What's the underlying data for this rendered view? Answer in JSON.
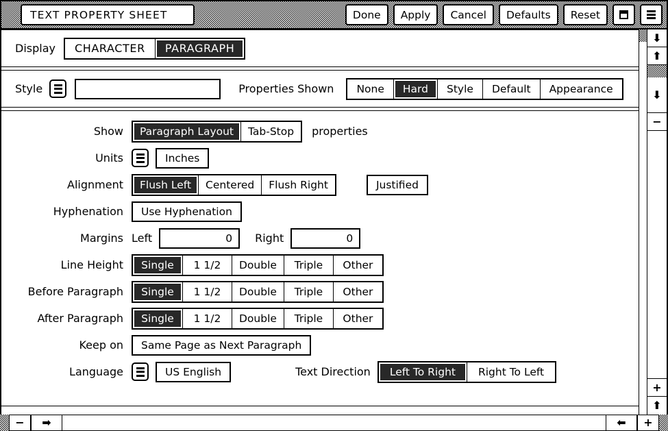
{
  "window": {
    "title": "TEXT PROPERTY SHEET",
    "buttons": [
      {
        "label": "Done",
        "name": "done-button"
      },
      {
        "label": "Apply",
        "name": "apply-button"
      },
      {
        "label": "Cancel",
        "name": "cancel-button"
      },
      {
        "label": "Defaults",
        "name": "defaults-button"
      },
      {
        "label": "Reset",
        "name": "reset-button"
      }
    ],
    "icon_buttons": [
      {
        "icon": "window-icon"
      },
      {
        "icon": "menu-icon"
      }
    ]
  },
  "display": {
    "label": "Display",
    "options": [
      {
        "label": "CHARACTER",
        "selected": false
      },
      {
        "label": "PARAGRAPH",
        "selected": true
      }
    ]
  },
  "style": {
    "label": "Style",
    "menu_icon": "menu-icon",
    "value": "",
    "placeholder": ""
  },
  "properties_shown": {
    "label": "Properties Shown",
    "options": [
      {
        "label": "None",
        "selected": false
      },
      {
        "label": "Hard",
        "selected": true
      },
      {
        "label": "Style",
        "selected": false
      },
      {
        "label": "Default",
        "selected": false
      },
      {
        "label": "Appearance",
        "selected": false
      }
    ]
  },
  "show": {
    "label": "Show",
    "suffix": "properties",
    "options": [
      {
        "label": "Paragraph Layout",
        "selected": true
      },
      {
        "label": "Tab-Stop",
        "selected": false
      }
    ]
  },
  "units": {
    "label": "Units",
    "menu_icon": "menu-icon",
    "value": "Inches"
  },
  "alignment": {
    "label": "Alignment",
    "options": [
      {
        "label": "Flush Left",
        "selected": true
      },
      {
        "label": "Centered",
        "selected": false
      },
      {
        "label": "Flush Right",
        "selected": false
      }
    ],
    "justified": {
      "label": "Justified",
      "selected": false
    }
  },
  "hyphenation": {
    "label": "Hyphenation",
    "toggle": {
      "label": "Use Hyphenation",
      "selected": false
    }
  },
  "margins": {
    "label": "Margins",
    "left_label": "Left",
    "left_value": "0",
    "right_label": "Right",
    "right_value": "0"
  },
  "line_height": {
    "label": "Line Height",
    "options": [
      {
        "label": "Single",
        "selected": true
      },
      {
        "label": "1 1/2",
        "selected": false
      },
      {
        "label": "Double",
        "selected": false
      },
      {
        "label": "Triple",
        "selected": false
      },
      {
        "label": "Other",
        "selected": false
      }
    ]
  },
  "before_paragraph": {
    "label": "Before Paragraph",
    "options": [
      {
        "label": "Single",
        "selected": true
      },
      {
        "label": "1 1/2",
        "selected": false
      },
      {
        "label": "Double",
        "selected": false
      },
      {
        "label": "Triple",
        "selected": false
      },
      {
        "label": "Other",
        "selected": false
      }
    ]
  },
  "after_paragraph": {
    "label": "After Paragraph",
    "options": [
      {
        "label": "Single",
        "selected": true
      },
      {
        "label": "1 1/2",
        "selected": false
      },
      {
        "label": "Double",
        "selected": false
      },
      {
        "label": "Triple",
        "selected": false
      },
      {
        "label": "Other",
        "selected": false
      }
    ]
  },
  "keep_on": {
    "label": "Keep on",
    "toggle": {
      "label": "Same Page as Next Paragraph",
      "selected": false
    }
  },
  "language": {
    "label": "Language",
    "menu_icon": "menu-icon",
    "value": "US English"
  },
  "text_direction": {
    "label": "Text Direction",
    "options": [
      {
        "label": "Left To Right",
        "selected": true
      },
      {
        "label": "Right To Left",
        "selected": false
      }
    ]
  },
  "scrollbars": {
    "vertical": [
      {
        "icon": "arrow-down-icon"
      },
      {
        "icon": "arrow-up-icon"
      },
      {
        "icon": "arrow-down-icon"
      },
      {
        "icon": "minus-icon"
      },
      {
        "icon": "plus-icon"
      },
      {
        "icon": "arrow-up-icon"
      }
    ],
    "horizontal": {
      "minus": "minus-icon",
      "right": "arrow-right-icon",
      "left": "arrow-left-icon",
      "plus": "plus-icon"
    }
  },
  "colors": {
    "selected_bg": "#282828",
    "selected_fg": "#ffffff",
    "border": "#000000",
    "background": "#ffffff"
  }
}
